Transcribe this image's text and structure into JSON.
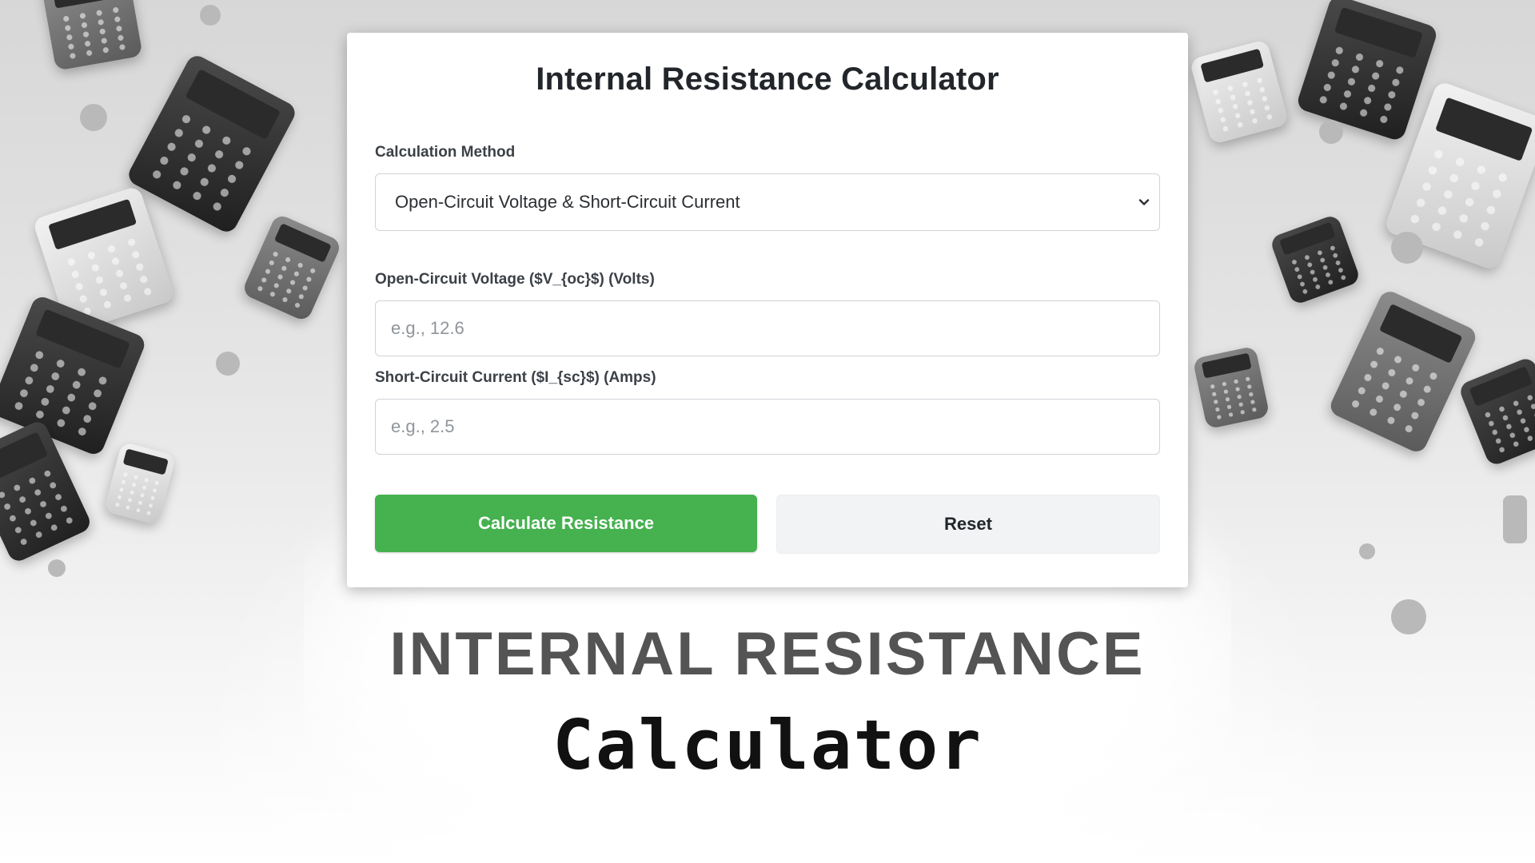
{
  "card": {
    "title": "Internal Resistance Calculator",
    "method_label": "Calculation Method",
    "method_selected": "Open-Circuit Voltage & Short-Circuit Current",
    "voc_label": "Open-Circuit Voltage ($V_{oc}$) (Volts)",
    "voc_placeholder": "e.g., 12.6",
    "isc_label": "Short-Circuit Current ($I_{sc}$) (Amps)",
    "isc_placeholder": "e.g., 2.5",
    "calculate_label": "Calculate Resistance",
    "reset_label": "Reset"
  },
  "caption": {
    "headline": "INTERNAL RESISTANCE",
    "subline": "Calculator"
  },
  "colors": {
    "calculate_button": "#45b14f",
    "reset_button": "#f2f3f5",
    "headline": "#545454"
  },
  "icons": {
    "select_arrow": "chevron-down-icon"
  }
}
